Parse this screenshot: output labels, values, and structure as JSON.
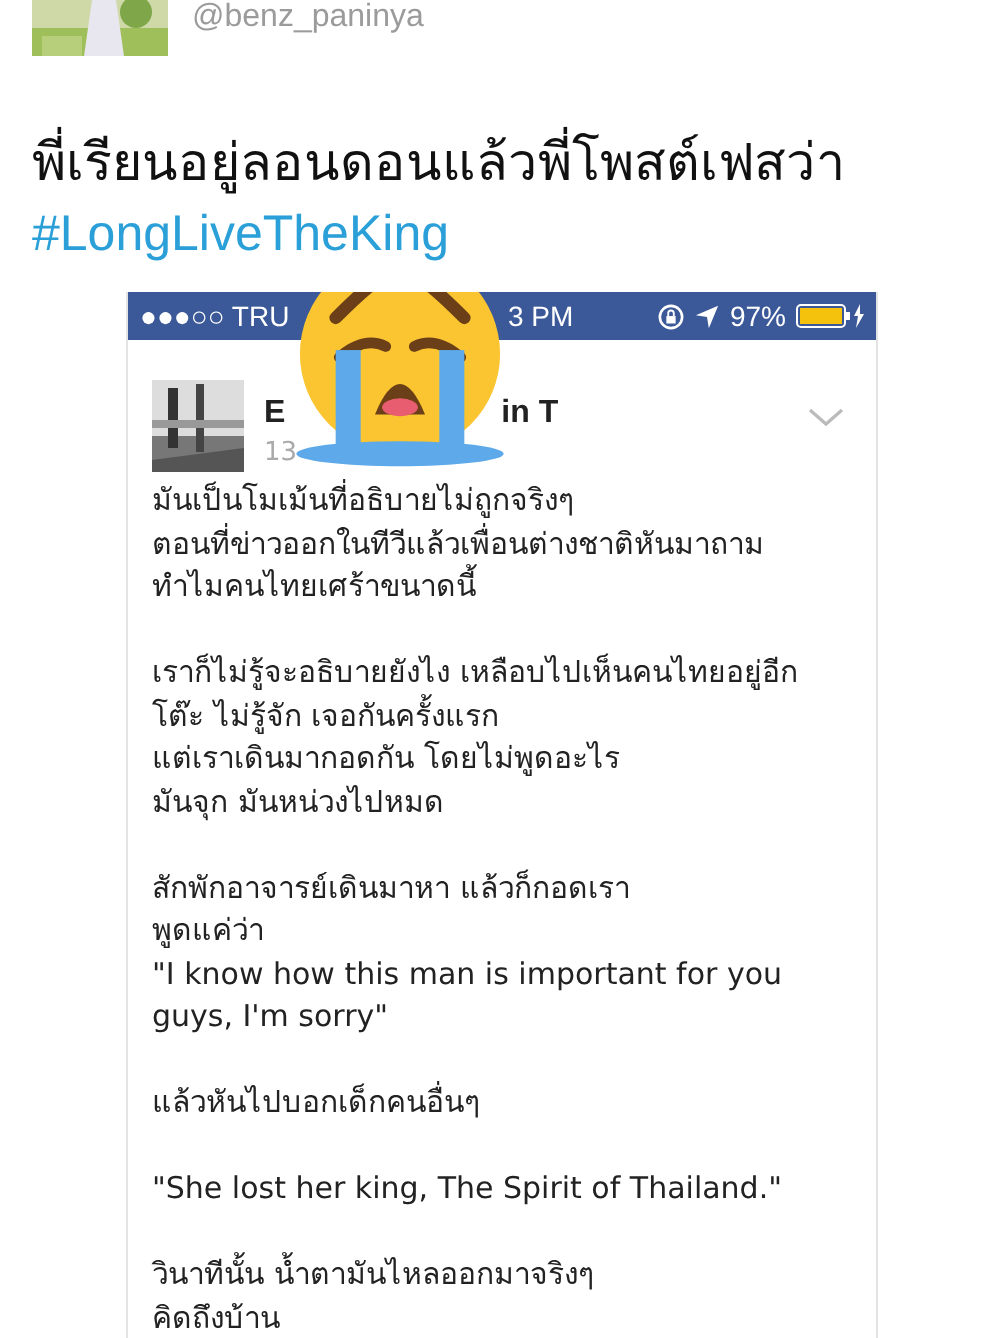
{
  "tweet": {
    "handle": "@benz_paninya",
    "text": "พี่เรียนอยู่ลอนดอนแล้วพี่โพสต์เฟสว่า",
    "hashtag": "#LongLiveTheKing"
  },
  "screenshot": {
    "status_bar": {
      "carrier": "●●●○○ TRU",
      "time": "3 PM",
      "battery": "97%"
    },
    "post": {
      "author_start": "E",
      "author_end": "in T",
      "time": "13",
      "paragraphs": [
        "มันเป็นโมเม้นที่อธิบายไม่ถูกจริงๆ\nตอนที่ข่าวออกในทีวีแล้วเพื่อนต่างชาติหันมาถาม\nทำไมคนไทยเศร้าขนาดนี้",
        "เราก็ไม่รู้จะอธิบายยังไง เหลือบไปเห็นคนไทยอยู่อีก\nโต๊ะ ไม่รู้จัก เจอกันครั้งแรก\nแต่เราเดินมากอดกัน โดยไม่พูดอะไร\nมันจุก มันหน่วงไปหมด",
        "สักพักอาจารย์เดินมาหา แล้วก็กอดเรา\nพูดแค่ว่า\n\"I know how this man is important for you\nguys, I'm sorry\"",
        "แล้วหันไปบอกเด็กคนอื่นๆ",
        "\"She lost her king, The Spirit of Thailand.\"",
        "วินาทีนั้น น้ำตามันไหลออกมาจริงๆ\nคิดถึงบ้าน"
      ]
    }
  }
}
